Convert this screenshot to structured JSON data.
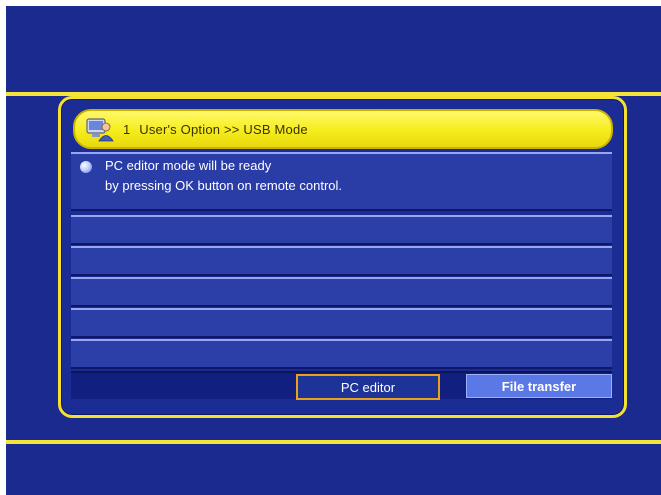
{
  "header": {
    "number": "1",
    "title": "User's Option >> USB Mode"
  },
  "message": {
    "line1": "PC editor mode will be ready",
    "line2": "by pressing OK button on remote control."
  },
  "buttons": {
    "pc_editor": "PC editor",
    "file_transfer": "File transfer"
  },
  "colors": {
    "background": "#1a2a8e",
    "accent": "#f4e12f",
    "selected_border": "#e7a21a",
    "inactive_button": "#5a78e6"
  }
}
